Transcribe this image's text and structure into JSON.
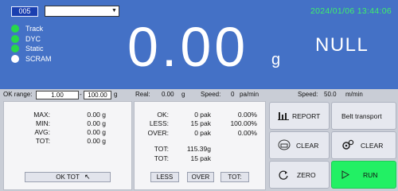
{
  "header": {
    "id_value": "005",
    "datetime": "2024/01/06 13:44:06",
    "status_items": [
      {
        "label": "Track",
        "color": "#27d74b"
      },
      {
        "label": "DYC",
        "color": "#27d74b"
      },
      {
        "label": "Static",
        "color": "#27d74b"
      },
      {
        "label": "SCRAM",
        "color": "#ffffff"
      }
    ],
    "weight_value": "0.00",
    "weight_unit": "g",
    "result_status": "NULL"
  },
  "infobar": {
    "ok_range_label": "OK range:",
    "range_min": "1.00",
    "range_sep": "-",
    "range_max": "100.00",
    "range_unit": "g",
    "real_label": "Real:",
    "real_value": "0.00",
    "real_unit": "g",
    "speed_label": "Speed:",
    "speed_value": "0",
    "speed_unit": "pa/min",
    "speed2_label": "Speed:",
    "speed2_value": "50.0",
    "speed2_unit": "m/min"
  },
  "stats_panel": {
    "rows": [
      {
        "label": "MAX:",
        "value": "0.00 g"
      },
      {
        "label": "MIN:",
        "value": "0.00 g"
      },
      {
        "label": "AVG:",
        "value": "0.00 g"
      },
      {
        "label": "TOT:",
        "value": "0.00 g"
      }
    ],
    "ok_tot_button": "OK TOT"
  },
  "count_panel": {
    "rows": [
      {
        "label": "OK:",
        "count": "0 pak",
        "percent": "0.00%"
      },
      {
        "label": "LESS:",
        "count": "15 pak",
        "percent": "100.00%"
      },
      {
        "label": "OVER:",
        "count": "0 pak",
        "percent": "0.00%"
      }
    ],
    "tot_weight_label": "TOT:",
    "tot_weight_value": "115.39g",
    "tot_count_label": "TOT:",
    "tot_count_value": "15 pak",
    "buttons": {
      "less": "LESS",
      "over": "OVER",
      "tot": "TOT:"
    }
  },
  "controls": {
    "report": "REPORT",
    "belt_transport": "Belt transport",
    "clear1": "CLEAR",
    "clear2": "CLEAR",
    "zero": "ZERO",
    "run": "RUN"
  },
  "colors": {
    "header_bg": "#4471c6",
    "datetime": "#3ef06a",
    "run_button": "#22f064",
    "id_box": "#1a3fb0"
  }
}
